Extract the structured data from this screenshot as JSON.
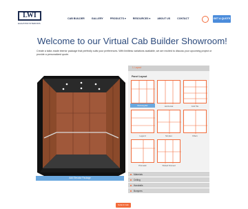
{
  "brand": {
    "logo_text": "LWI",
    "tagline": "ELEVATOR INTERIORS"
  },
  "nav": {
    "items": [
      "CAB BUILDER",
      "GALLERY",
      "PRODUCTS ▾",
      "RESOURCES ▾",
      "ABOUT US",
      "CONTACT"
    ],
    "quote_label": "GET A QUOTE →"
  },
  "page": {
    "title": "Welcome to our Virtual Cab Builder Showroom!",
    "intro": "Create a tailor-made interior package that perfectly suits your preferences. With limitless variations available, we are excited to discuss your upcoming project or provide a personalized quote."
  },
  "preview": {
    "caption": "Add Elevator Package"
  },
  "panel": {
    "header": "1. Layout",
    "section_label": "Panel Layout",
    "layouts": [
      "Rectangular",
      "Horizontal",
      "Grid Tile",
      "Legend",
      "Simplex",
      "Fillers",
      "Prismatic",
      "Slotted Framed"
    ],
    "selected": "Rectangular",
    "accordion": [
      "Materials",
      "Ceiling",
      "Handrails",
      "Bumpers"
    ]
  },
  "submit_label": "Submit Cab",
  "colors": {
    "accent": "#f26b3a",
    "brand_blue": "#2c4a7c",
    "button_blue": "#4b8cdb"
  }
}
